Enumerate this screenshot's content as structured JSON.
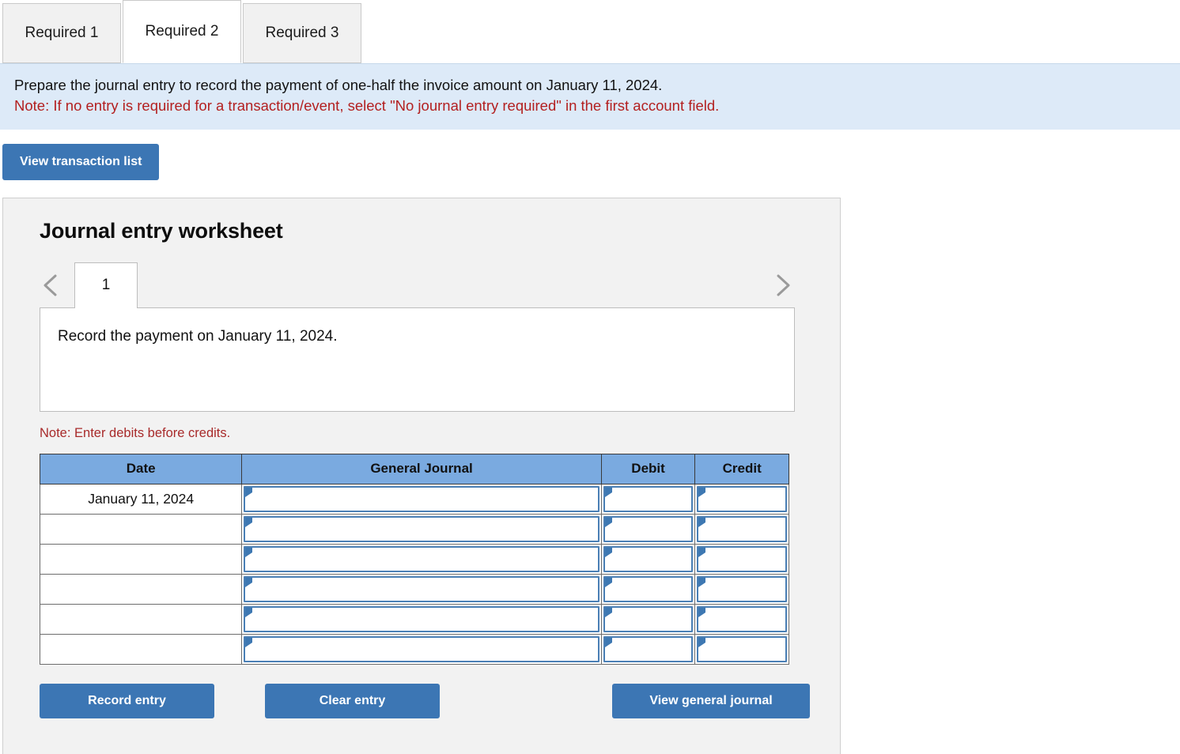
{
  "tabs": [
    {
      "label": "Required 1",
      "active": false
    },
    {
      "label": "Required 2",
      "active": true
    },
    {
      "label": "Required 3",
      "active": false
    }
  ],
  "instruction": {
    "prompt": "Prepare the journal entry to record the payment of one-half the invoice amount on January 11, 2024.",
    "note": "Note: If no entry is required for a transaction/event, select \"No journal entry required\" in the first account field."
  },
  "toolbar": {
    "view_transaction_list_label": "View transaction list"
  },
  "worksheet": {
    "title": "Journal entry worksheet",
    "pager": {
      "prev_icon": "chevron-left-icon",
      "next_icon": "chevron-right-icon",
      "pages": [
        "1"
      ],
      "current_page": "1"
    },
    "description": "Record the payment on January 11, 2024.",
    "debits_note": "Note: Enter debits before credits.",
    "table": {
      "headers": [
        "Date",
        "General Journal",
        "Debit",
        "Credit"
      ],
      "rows": [
        {
          "date": "January 11, 2024",
          "general_journal": "",
          "debit": "",
          "credit": ""
        },
        {
          "date": "",
          "general_journal": "",
          "debit": "",
          "credit": ""
        },
        {
          "date": "",
          "general_journal": "",
          "debit": "",
          "credit": ""
        },
        {
          "date": "",
          "general_journal": "",
          "debit": "",
          "credit": ""
        },
        {
          "date": "",
          "general_journal": "",
          "debit": "",
          "credit": ""
        },
        {
          "date": "",
          "general_journal": "",
          "debit": "",
          "credit": ""
        }
      ]
    },
    "actions": {
      "record_entry_label": "Record entry",
      "clear_entry_label": "Clear entry",
      "view_general_journal_label": "View general journal"
    }
  },
  "colors": {
    "button_blue": "#3c76b4",
    "table_header_blue": "#7aaae0",
    "banner_blue": "#ddeaf8",
    "note_red": "#b32020",
    "panel_gray": "#f2f2f2",
    "input_border_blue": "#4a7fb5"
  }
}
